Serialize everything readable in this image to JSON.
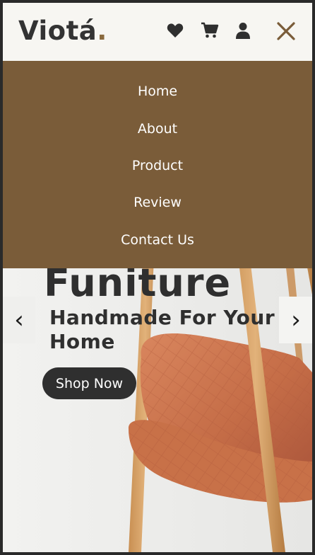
{
  "brand": {
    "name": "Viotá",
    "dot": "."
  },
  "header_icons": [
    "heart-icon",
    "cart-icon",
    "user-icon",
    "close-icon"
  ],
  "menu": {
    "items": [
      {
        "label": "Home"
      },
      {
        "label": "About"
      },
      {
        "label": "Product"
      },
      {
        "label": "Review"
      },
      {
        "label": "Contact Us"
      }
    ]
  },
  "hero": {
    "title": "Funiture",
    "subtitle": "Handmade For Your Home",
    "cta_label": "Shop Now",
    "prev_label": "‹",
    "next_label": "›"
  },
  "colors": {
    "menu_bg": "#7a5c39",
    "accent_dot": "#8a6a3e",
    "text_dark": "#2f2f2f",
    "header_bg": "#f7f6f2",
    "hero_bg": "#ededeb"
  }
}
